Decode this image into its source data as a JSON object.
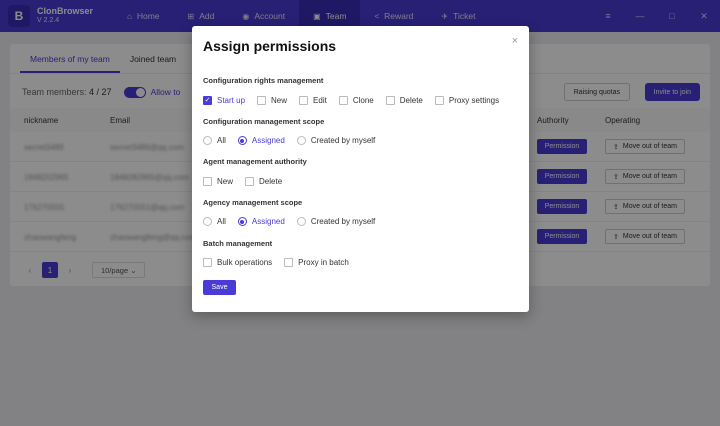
{
  "app": {
    "name": "ClonBrowser",
    "version": "V 2.2.4",
    "logo_letter": "B"
  },
  "nav": [
    {
      "label": "Home",
      "icon": "⌂"
    },
    {
      "label": "Add",
      "icon": "⊞"
    },
    {
      "label": "Account",
      "icon": "◉"
    },
    {
      "label": "Team",
      "icon": "▣"
    },
    {
      "label": "Reward",
      "icon": "<"
    },
    {
      "label": "Ticket",
      "icon": "✈"
    }
  ],
  "window_controls": {
    "menu": "≡",
    "min": "—",
    "max": "□",
    "close": "✕"
  },
  "team": {
    "tabs": [
      "Members of my team",
      "Joined team"
    ],
    "members_label": "Team members:",
    "members_count": "4 / 27",
    "allow_label": "Allow to",
    "raise_label": "Raising quotas",
    "invite_label": "Invite to join",
    "columns": {
      "nickname": "nickname",
      "email": "Email",
      "authority": "Authority",
      "operating": "Operating"
    },
    "rows": [
      {
        "nickname": "secret3489",
        "email": "secret3489@qq.com"
      },
      {
        "nickname": "1848202965",
        "email": "1848282965@qq.com"
      },
      {
        "nickname": "176270555",
        "email": "176270551@qq.com"
      },
      {
        "nickname": "zhaowangfeng",
        "email": "zhaowangfeng@qq.com"
      }
    ],
    "permission_label": "Permission",
    "move_label": "Move out of team",
    "move_icon": "⇪",
    "pager": {
      "prev": "‹",
      "current": "1",
      "next": "›",
      "size": "10/page ⌄"
    }
  },
  "modal": {
    "title": "Assign permissions",
    "close": "×",
    "check": "✓",
    "sections": {
      "config_rights": "Configuration rights management",
      "config_scope": "Configuration management scope",
      "agent_auth": "Agent management authority",
      "agency_scope": "Agency management scope",
      "batch": "Batch management"
    },
    "config_rights_opts": [
      "Start up",
      "New",
      "Edit",
      "Clone",
      "Delete",
      "Proxy settings"
    ],
    "scope_opts": [
      "All",
      "Assigned",
      "Created by myself"
    ],
    "agent_opts": [
      "New",
      "Delete"
    ],
    "batch_opts": [
      "Bulk operations",
      "Proxy in batch"
    ],
    "save_label": "Save"
  }
}
